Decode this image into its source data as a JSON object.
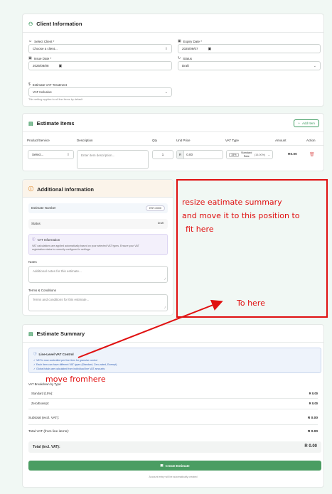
{
  "client_info": {
    "title": "Client Information",
    "select_client_label": "Select Client *",
    "select_client_value": "Choose a client...",
    "expiry_label": "Expiry Date *",
    "expiry_value": "2025/09/07",
    "issue_label": "Issue Date *",
    "issue_value": "2025/08/08",
    "status_label": "Status",
    "status_value": "Draft",
    "vat_treatment_label": "Estimate VAT Treatment",
    "vat_treatment_value": "VAT Inclusive",
    "vat_hint": "This setting applies to all line items by default"
  },
  "estimate_items": {
    "title": "Estimate Items",
    "add_button": "Add Item",
    "columns": [
      "Product/Service",
      "Description",
      "Qty",
      "Unit Price",
      "VAT Type",
      "Amount",
      "Action"
    ],
    "row": {
      "product": "Select...",
      "description_placeholder": "Enter item description...",
      "qty": "1",
      "unit_price": "0.00",
      "currency": "R",
      "vat_badge": "15%",
      "vat_type_line1": "Standard",
      "vat_type_line2": "Rate",
      "vat_rate": "(15.00%)",
      "amount": "R0.00"
    }
  },
  "additional_info": {
    "title": "Additional Information",
    "estimate_number_label": "Estimate Number",
    "estimate_number_value": "EST-0000",
    "status_label": "Status",
    "status_value": "Draft",
    "vat_info_title": "VAT Information",
    "vat_info_text_1": "VAT calculations are applied automatically based on your selected VAT types. Ensure your VAT",
    "vat_info_text_2": "registration status is correctly configured in settings.",
    "notes_label": "Notes",
    "notes_placeholder": "Additional notes for this estimate...",
    "terms_label": "Terms & Conditions",
    "terms_placeholder": "Terms and conditions for this estimate..."
  },
  "summary": {
    "title": "Estimate Summary",
    "line_vat_title": "Line-Level VAT Control",
    "line_vat_1": "✓ VAT is now controlled per line item for granular control",
    "line_vat_2": "✓ Each item can have different VAT types (Standard, Zero-rated, Exempt)",
    "line_vat_3": "✓ Global totals are calculated from individual line VAT amounts",
    "breakdown_title": "VAT Breakdown by Type:",
    "standard_label": "Standard (15%):",
    "standard_value": "R 0.00",
    "zero_label": "Zero/Exempt:",
    "zero_value": "R 0.00",
    "subtotal_label": "Subtotal (excl. VAT):",
    "subtotal_value": "R 0.00",
    "total_vat_label": "Total VAT (from line items):",
    "total_vat_value": "R 0.00",
    "total_label": "Total (incl. VAT):",
    "total_value": "R 0.00",
    "create_button": "Create Estimate",
    "footer_note": "Account entry will be automatically created"
  },
  "annotations": {
    "instruction_1": "resize eatimate summary",
    "instruction_2": "and move it to this position to",
    "instruction_3": "fit here",
    "to_here": "To here",
    "move_from": "move fromhere"
  },
  "colors": {
    "accent": "#3c9a5f",
    "annotation_red": "#e01010",
    "button_green": "#4a9d62"
  }
}
